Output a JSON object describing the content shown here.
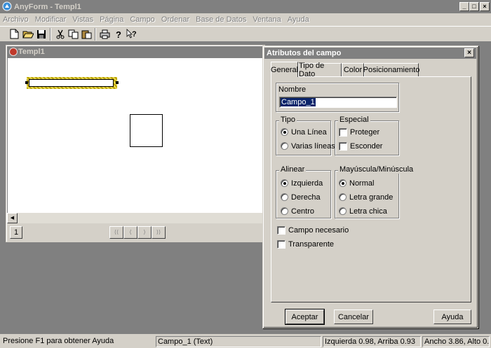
{
  "app": {
    "title": "AnyForm - Templ1",
    "minimize": "_",
    "restore": "□",
    "close": "×"
  },
  "menu": [
    "Archivo",
    "Modificar",
    "Vistas",
    "Página",
    "Campo",
    "Ordenar",
    "Base de Datos",
    "Ventana",
    "Ayuda"
  ],
  "toolbar": {
    "icons": [
      "new-icon",
      "open-icon",
      "save-icon",
      "cut-icon",
      "copy-icon",
      "paste-icon",
      "print-icon",
      "help-icon",
      "context-help-icon"
    ],
    "glyphs": [
      "🗋",
      "📂",
      "💾",
      "✂",
      "⎘",
      "📋",
      "🖶",
      "?",
      "↖?"
    ]
  },
  "child": {
    "title": "Templ1",
    "page_number": "1",
    "nav_glyphs": [
      "⟨⟨",
      "⟨",
      "⟩",
      "⟩⟩"
    ]
  },
  "dialog": {
    "title": "Atributos del campo",
    "tabs": [
      "General",
      "Tipo de Dato",
      "Color",
      "Posicionamiento"
    ],
    "active_tab": "General",
    "name_label": "Nombre",
    "name_value": "Campo_1",
    "tipo": {
      "label": "Tipo",
      "options": [
        "Una Línea",
        "Varias líneas"
      ],
      "selected": "Una Línea"
    },
    "especial": {
      "label": "Especial",
      "options": [
        "Proteger",
        "Esconder"
      ]
    },
    "alinear": {
      "label": "Alinear",
      "options": [
        "Izquierda",
        "Derecha",
        "Centro"
      ],
      "selected": "Izquierda"
    },
    "mayus": {
      "label": "Mayúscula/Minúscula",
      "options": [
        "Normal",
        "Letra grande",
        "Letra chica"
      ],
      "selected": "Normal"
    },
    "campo_necesario": "Campo necesario",
    "transparente": "Transparente",
    "buttons": {
      "ok": "Aceptar",
      "cancel": "Cancelar",
      "help": "Ayuda"
    }
  },
  "status": {
    "help": "Presione F1 para obtener Ayuda",
    "field": "Campo_1 (Text)",
    "position": "Izquierda 0.98, Arriba 0.93",
    "size": "Ancho 3.86, Alto 0."
  }
}
